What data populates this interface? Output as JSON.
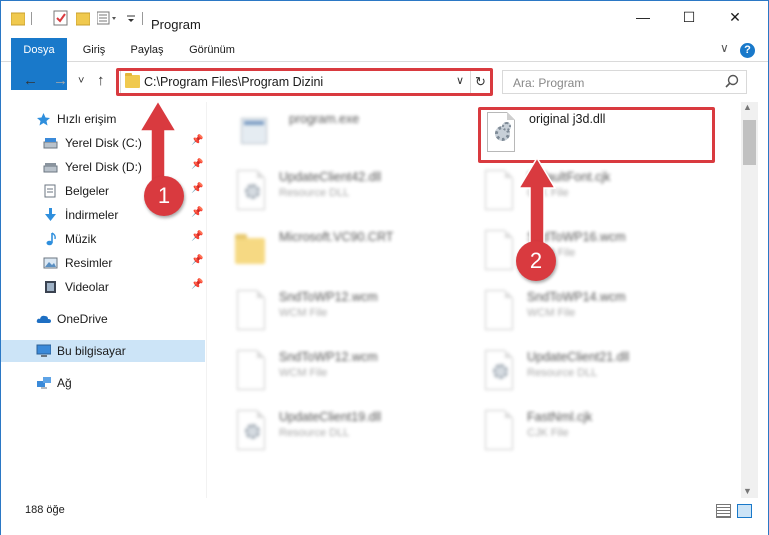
{
  "window": {
    "title": "Program",
    "minimize_label": "—",
    "maximize_label": "☐",
    "close_label": "✕"
  },
  "ribbon": {
    "tabs": [
      "Dosya",
      "Giriş",
      "Paylaş",
      "Görünüm"
    ],
    "expand_label": "∨",
    "help_label": "?"
  },
  "navigation": {
    "back_label": "←",
    "forward_label": "→",
    "recent_label": "˅",
    "up_label": "↑"
  },
  "address": {
    "path": "C:\\Program Files\\Program Dizini",
    "dropdown_label": "∨",
    "refresh_label": "↻"
  },
  "search": {
    "placeholder": "Ara: Program",
    "icon": "search-icon"
  },
  "sidebar": {
    "quick_access": "Hızlı erişim",
    "items": [
      {
        "label": "Yerel Disk (C:)",
        "icon": "drive-icon",
        "pinned": true
      },
      {
        "label": "Yerel Disk (D:)",
        "icon": "drive-icon",
        "pinned": true
      },
      {
        "label": "Belgeler",
        "icon": "documents-icon",
        "pinned": true
      },
      {
        "label": "İndirmeler",
        "icon": "downloads-icon",
        "pinned": true
      },
      {
        "label": "Müzik",
        "icon": "music-icon",
        "pinned": true
      },
      {
        "label": "Resimler",
        "icon": "pictures-icon",
        "pinned": true
      },
      {
        "label": "Videolar",
        "icon": "videos-icon",
        "pinned": true
      }
    ],
    "onedrive": "OneDrive",
    "this_pc": "Bu bilgisayar",
    "network": "Ağ"
  },
  "files": [
    {
      "name": "program.exe",
      "type": "",
      "icon": "exe-icon",
      "blurred": true
    },
    {
      "name": "original j3d.dll",
      "type": "",
      "icon": "dll-file-icon",
      "blurred": false
    },
    {
      "name": "UpdateClient42.dll",
      "type": "Resource DLL",
      "icon": "dll-file-icon",
      "blurred": true
    },
    {
      "name": "DefaultFont.cjk",
      "type": "CJK File",
      "icon": "file-icon",
      "blurred": true
    },
    {
      "name": "Microsoft.VC90.CRT",
      "type": "",
      "icon": "folder-icon",
      "blurred": true
    },
    {
      "name": "SndToWP16.wcm",
      "type": "WCM File",
      "icon": "file-icon",
      "blurred": true
    },
    {
      "name": "SndToWP12.wcm",
      "type": "WCM File",
      "icon": "file-icon",
      "blurred": true
    },
    {
      "name": "SndToWP14.wcm",
      "type": "WCM File",
      "icon": "file-icon",
      "blurred": true
    },
    {
      "name": "SndToWP12.wcm",
      "type": "WCM File",
      "icon": "file-icon",
      "blurred": true
    },
    {
      "name": "UpdateClient21.dll",
      "type": "Resource DLL",
      "icon": "dll-file-icon",
      "blurred": true
    },
    {
      "name": "UpdateClient19.dll",
      "type": "Resource DLL",
      "icon": "dll-file-icon",
      "blurred": true
    },
    {
      "name": "FastNml.cjk",
      "type": "CJK File",
      "icon": "file-icon",
      "blurred": true
    }
  ],
  "status": {
    "item_count": "188 öğe"
  },
  "annotations": {
    "step1": "1",
    "step2": "2",
    "highlight_color": "#d93a3f"
  },
  "colors": {
    "accent": "#1979ca",
    "selection": "#cce4f7"
  }
}
